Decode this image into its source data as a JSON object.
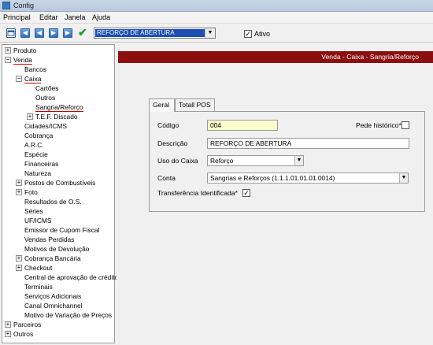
{
  "window": {
    "title": "Config"
  },
  "menu": {
    "items": [
      "Principal",
      "Editar",
      "Janela",
      "Ajuda"
    ]
  },
  "toolbar": {
    "nav_icons": [
      "new-record-icon",
      "first-record-icon",
      "previous-record-icon",
      "next-record-icon",
      "last-record-icon",
      "confirm-check-icon"
    ],
    "record_selected": "REFORÇO DE ABERTURA",
    "ativo_label": "Ativo",
    "ativo_checked": true
  },
  "tree": {
    "produto": "Produto",
    "venda": "Venda",
    "bancos": "Bancos",
    "caixa": "Caixa",
    "cartoes": "Cartões",
    "outros_caixa": "Outros",
    "sangria": "Sangria/Reforço",
    "tef": "T.E.F. Discado",
    "cidades": "Cidades/ICMS",
    "cobranca": "Cobrança",
    "arc": "A.R.C.",
    "especie": "Espécie",
    "financeiras": "Financeiras",
    "natureza": "Natureza",
    "postos": "Postos de Combustíveis",
    "foto": "Foto",
    "resultados": "Resultados de O.S.",
    "series": "Séries",
    "uf": "UF/ICMS",
    "emissor": "Emissor de Cupom Fiscal",
    "vendas_perdidas": "Vendas Perdidas",
    "motivos_devolucao": "Motivos de Devolução",
    "cobranca_bancaria": "Cobrança Bancária",
    "checkout": "Checkout",
    "central": "Central de aprovação de crédito",
    "terminais": "Terminais",
    "servicos": "Serviços Adicionais",
    "canal": "Canal Omnichannel",
    "motivo_variacao": "Motivo de Variação de Preços",
    "parceiros": "Parceiros",
    "outros_root": "Outros"
  },
  "content": {
    "breadcrumb": "Venda - Caixa - Sangria/Reforço",
    "tabs": [
      "Geral",
      "Totall POS"
    ],
    "form": {
      "codigo_label": "Código",
      "codigo_value": "004",
      "pede_historico_label": "Pede histórico*",
      "pede_historico_checked": false,
      "descricao_label": "Descrição",
      "descricao_value": "REFORÇO DE ABERTURA",
      "uso_caixa_label": "Uso do Caixa",
      "uso_caixa_value": "Reforço",
      "conta_label": "Conta",
      "conta_value": "Sangrias e Reforços (1.1.1.01.01.01.0014)",
      "transferencia_label": "Transferência Identificada*",
      "transferencia_checked": true
    }
  },
  "colors": {
    "banner": "#8b0f0f",
    "selection": "#1c4fb0",
    "highlight_field": "#fffccc"
  }
}
